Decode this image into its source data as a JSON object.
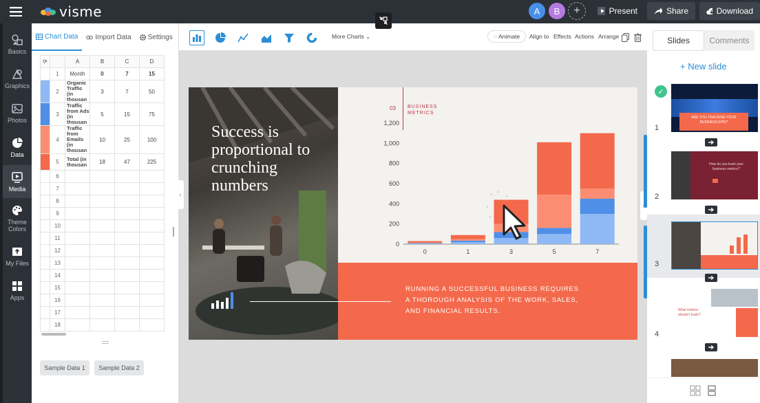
{
  "app": {
    "logo_text": "visme"
  },
  "avatars": [
    {
      "initial": "A",
      "color": "#4a8fe7"
    },
    {
      "initial": "B",
      "color": "#b57be0"
    }
  ],
  "topbar": {
    "present_label": "Present",
    "share_label": "Share",
    "download_label": "Download"
  },
  "leftrail": {
    "items": [
      {
        "label": "Basics",
        "icon": "shapes-icon"
      },
      {
        "label": "Graphics",
        "icon": "graphics-icon"
      },
      {
        "label": "Photos",
        "icon": "photo-icon"
      },
      {
        "label": "Data",
        "icon": "pie-chart-icon"
      },
      {
        "label": "Media",
        "icon": "media-icon"
      },
      {
        "label": "Theme Colors",
        "icon": "palette-icon"
      },
      {
        "label": "My Files",
        "icon": "upload-icon"
      },
      {
        "label": "Apps",
        "icon": "apps-icon"
      }
    ]
  },
  "datapanel": {
    "tabs": {
      "chart_data": "Chart Data",
      "import_data": "Import Data",
      "settings": "Settings"
    },
    "columns": [
      "A",
      "B",
      "C",
      "D"
    ],
    "rows": [
      {
        "n": "1",
        "a": "Month",
        "b": "0",
        "c": "7",
        "d": "15"
      },
      {
        "n": "2",
        "a": "Organic Traffic (in thousan",
        "b": "3",
        "c": "7",
        "d": "50"
      },
      {
        "n": "3",
        "a": "Traffic from Ads (in thousan",
        "b": "5",
        "c": "15",
        "d": "75"
      },
      {
        "n": "4",
        "a": "Traffic from Emails (in thousan",
        "b": "10",
        "c": "25",
        "d": "100"
      },
      {
        "n": "5",
        "a": "Total (in thousan",
        "b": "18",
        "c": "47",
        "d": "225"
      }
    ],
    "empty_rows": [
      "6",
      "7",
      "8",
      "9",
      "10",
      "11",
      "12",
      "13",
      "14",
      "15",
      "16",
      "17",
      "18"
    ],
    "sample_data_1": "Sample Data 1",
    "sample_data_2": "Sample Data 2"
  },
  "charttoolbar": {
    "more_charts": "More Charts",
    "animate": "Animate",
    "align_to": "Align to",
    "effects": "Effects",
    "actions": "Actions",
    "arrange": "Arrange"
  },
  "slide": {
    "title": "Success is proportional to crunching numbers",
    "section_number": "03",
    "section_label_line1": "BUSINESS",
    "section_label_line2": "METRICS",
    "body": "RUNNING A SUCCESSFUL BUSINESS REQUIRES A THOROUGH ANALYSIS OF THE WORK, SALES, AND FINANCIAL RESULTS."
  },
  "chart_data": {
    "type": "bar",
    "categories": [
      "0",
      "1",
      "3",
      "5",
      "7"
    ],
    "series": [
      {
        "color": "#8fb9f5",
        "values": [
          5,
          20,
          60,
          100,
          300
        ]
      },
      {
        "color": "#4f8fe8",
        "values": [
          5,
          15,
          60,
          60,
          150
        ]
      },
      {
        "color": "#fb8e72",
        "values": [
          5,
          15,
          80,
          330,
          100
        ]
      },
      {
        "color": "#f4694b",
        "values": [
          15,
          40,
          240,
          520,
          550
        ]
      }
    ],
    "ylim": [
      0,
      1200
    ],
    "yticks": [
      "0",
      "200",
      "400",
      "600",
      "800",
      "1,000",
      "1,200"
    ]
  },
  "rightpanel": {
    "tab_slides": "Slides",
    "tab_comments": "Comments",
    "new_slide": "+ New slide",
    "slide_numbers": [
      "1",
      "2",
      "3",
      "4"
    ]
  },
  "thumbs": {
    "t1_line1": "ARE YOU TRACKING YOUR",
    "t1_line2": "BUSINESS KPIS?",
    "t2_line1": "How do you track your",
    "t2_line2": "business metrics?",
    "t4_line1": "What metrics",
    "t4_line2": "should I track?"
  }
}
